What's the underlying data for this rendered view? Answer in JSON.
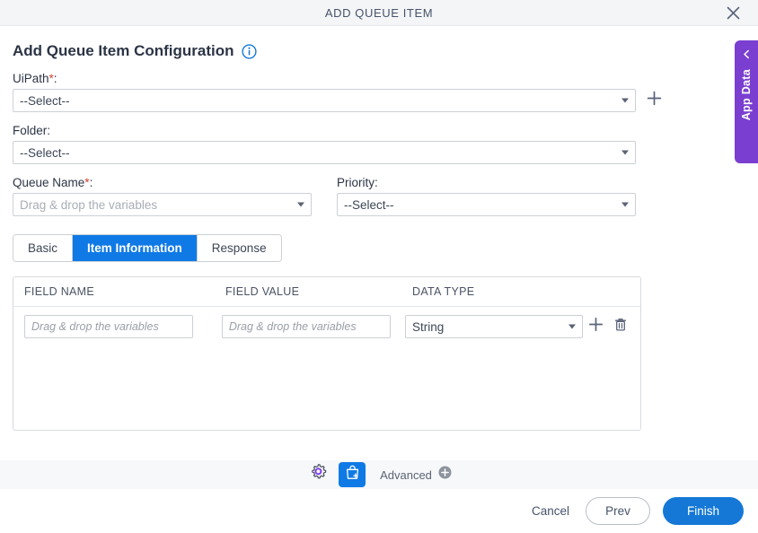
{
  "window": {
    "title": "ADD QUEUE ITEM",
    "close_icon": "close-icon"
  },
  "page": {
    "heading": "Add Queue Item Configuration",
    "info_icon": "info-icon"
  },
  "form": {
    "uipath": {
      "label": "UiPath",
      "required_marker": "*",
      "suffix": ":",
      "value": "--Select--",
      "add_icon": "plus-icon"
    },
    "folder": {
      "label": "Folder",
      "suffix": ":",
      "value": "--Select--"
    },
    "queue_name": {
      "label": "Queue Name",
      "required_marker": "*",
      "suffix": ":",
      "placeholder": "Drag & drop the variables",
      "value": ""
    },
    "priority": {
      "label": "Priority",
      "suffix": ":",
      "value": "--Select--"
    }
  },
  "tabs": [
    {
      "label": "Basic",
      "active": false
    },
    {
      "label": "Item Information",
      "active": true
    },
    {
      "label": "Response",
      "active": false
    }
  ],
  "table": {
    "columns": [
      "FIELD NAME",
      "FIELD VALUE",
      "DATA TYPE"
    ],
    "rows": [
      {
        "field_name_placeholder": "Drag & drop the variables",
        "field_name_value": "",
        "field_value_placeholder": "Drag & drop the variables",
        "field_value_value": "",
        "data_type": "String",
        "add_icon": "plus-icon",
        "delete_icon": "trash-icon"
      }
    ]
  },
  "toolbar": {
    "settings_icon": "gear-icon",
    "queue_item_icon": "shopping-bag-plus-icon",
    "advanced_label": "Advanced",
    "advanced_icon": "plus-circle-icon"
  },
  "footer": {
    "cancel_label": "Cancel",
    "prev_label": "Prev",
    "finish_label": "Finish"
  },
  "app_data_panel": {
    "label": "App Data",
    "collapse_icon": "chevron-left-icon"
  },
  "colors": {
    "accent_blue": "#0f7ae5",
    "finish_blue": "#1578d6",
    "app_data_purple": "#7a3fd0",
    "required_red": "#d04437",
    "titlebar_bg": "#f4f5f7",
    "toolbar_bg": "#f7f8fa"
  }
}
